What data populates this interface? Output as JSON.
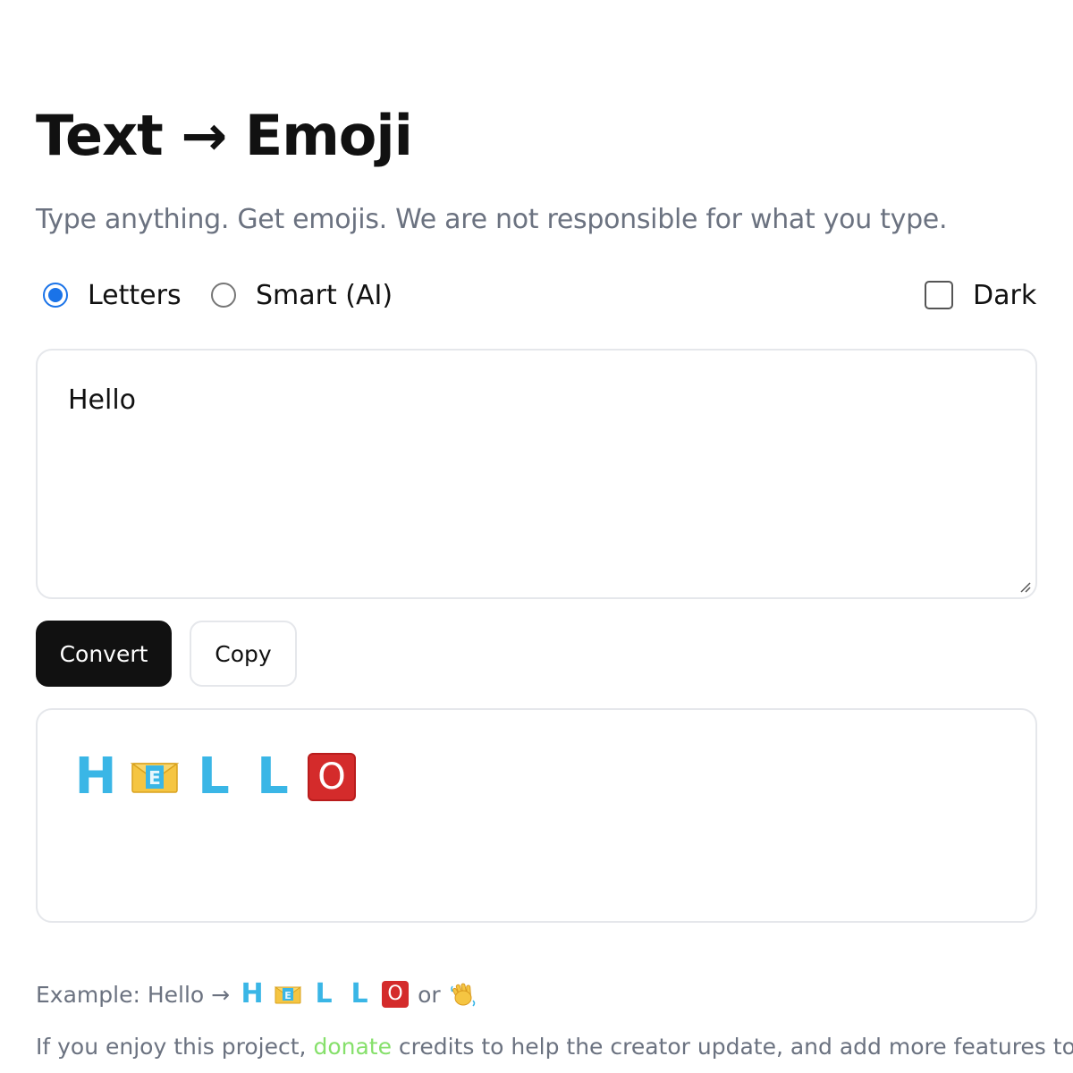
{
  "header": {
    "title": "Text → Emoji",
    "subtitle": "Type anything. Get emojis. We are not responsible for what you type."
  },
  "mode": {
    "options": [
      {
        "label": "Letters",
        "selected": true
      },
      {
        "label": "Smart (AI)",
        "selected": false
      }
    ],
    "dark_label": "Dark",
    "dark_checked": false
  },
  "input": {
    "value": "Hello"
  },
  "buttons": {
    "convert_label": "Convert",
    "copy_label": "Copy"
  },
  "output": {
    "tiles": [
      {
        "kind": "letter",
        "char": "H"
      },
      {
        "kind": "envelope",
        "char": "E"
      },
      {
        "kind": "letter",
        "char": "L"
      },
      {
        "kind": "letter",
        "char": "L"
      },
      {
        "kind": "o-button",
        "char": "O"
      }
    ]
  },
  "footer": {
    "example_prefix": "Example: Hello →",
    "example_or": "or",
    "example_alt_icon": "waving-hand-icon",
    "note_before": "If you enjoy this project,",
    "donate_link": "donate",
    "note_after": "credits to help the creator update, and add more features to it."
  },
  "colors": {
    "accent": "#1a73e8",
    "primary_button": "#111111",
    "letter_blue": "#3ab6e6",
    "o_button_red": "#d42b2b",
    "donate_green": "#86e06b"
  }
}
